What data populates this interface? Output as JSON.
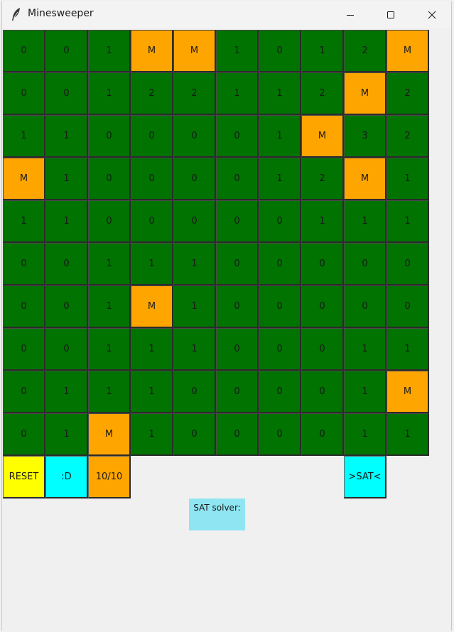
{
  "window": {
    "title": "Minesweeper",
    "icon": "feather-icon"
  },
  "colors": {
    "revealed": "#007300",
    "mine": "#ffa500",
    "reset": "#ffff00",
    "smiley": "#00ffff",
    "counter": "#ffa500",
    "sat_button": "#00ffff",
    "sat_label": "#8fe6f2"
  },
  "board": {
    "rows": [
      [
        "0",
        "0",
        "1",
        "M",
        "M",
        "1",
        "0",
        "1",
        "2",
        "M"
      ],
      [
        "0",
        "0",
        "1",
        "2",
        "2",
        "1",
        "1",
        "2",
        "M",
        "2"
      ],
      [
        "1",
        "1",
        "0",
        "0",
        "0",
        "0",
        "1",
        "M",
        "3",
        "2"
      ],
      [
        "M",
        "1",
        "0",
        "0",
        "0",
        "0",
        "1",
        "2",
        "M",
        "1"
      ],
      [
        "1",
        "1",
        "0",
        "0",
        "0",
        "0",
        "0",
        "1",
        "1",
        "1"
      ],
      [
        "0",
        "0",
        "1",
        "1",
        "1",
        "0",
        "0",
        "0",
        "0",
        "0"
      ],
      [
        "0",
        "0",
        "1",
        "M",
        "1",
        "0",
        "0",
        "0",
        "0",
        "0"
      ],
      [
        "0",
        "0",
        "1",
        "1",
        "1",
        "0",
        "0",
        "0",
        "1",
        "1"
      ],
      [
        "0",
        "1",
        "1",
        "1",
        "0",
        "0",
        "0",
        "0",
        "1",
        "M"
      ],
      [
        "0",
        "1",
        "M",
        "1",
        "0",
        "0",
        "0",
        "0",
        "1",
        "1"
      ]
    ]
  },
  "controls": {
    "reset_label": "RESET",
    "smiley_label": ":D",
    "mine_counter": "10/10",
    "sat_button_label": ">SAT<"
  },
  "sat": {
    "label": "SAT solver:"
  }
}
